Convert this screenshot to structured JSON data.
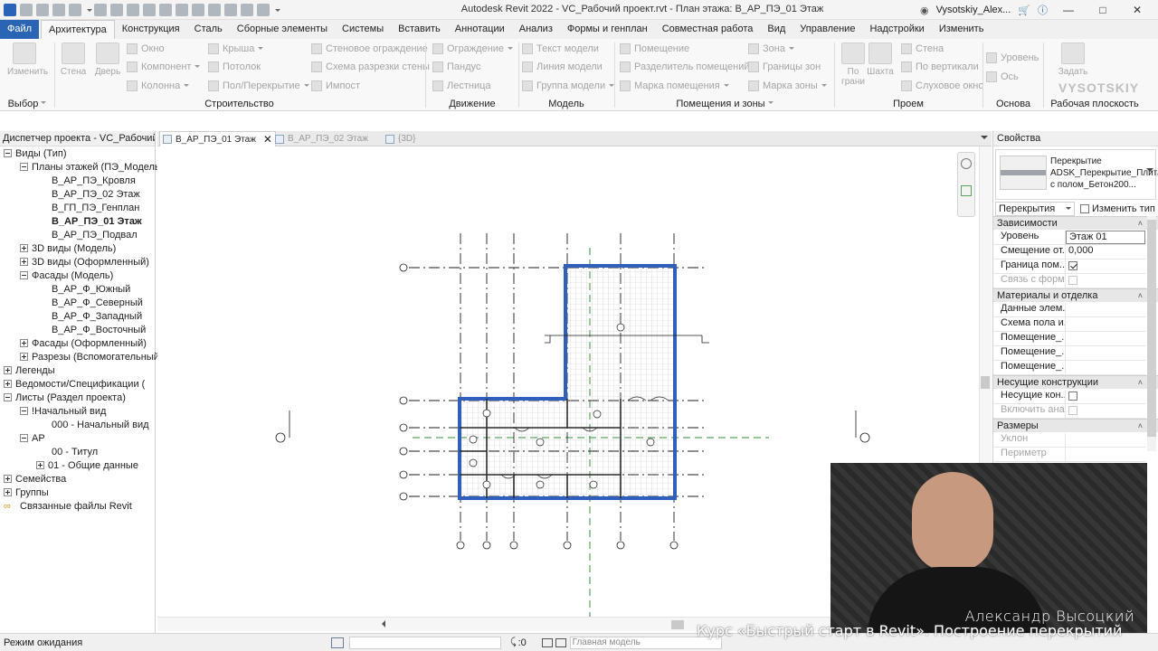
{
  "window": {
    "title": "Autodesk Revit 2022 - VC_Рабочий проект.rvt - План этажа: В_АР_ПЭ_01 Этаж",
    "user": "Vysotskiy_Alex..."
  },
  "tabs": [
    {
      "label": "Файл"
    },
    {
      "label": "Архитектура"
    },
    {
      "label": "Конструкция"
    },
    {
      "label": "Сталь"
    },
    {
      "label": "Сборные элементы"
    },
    {
      "label": "Системы"
    },
    {
      "label": "Вставить"
    },
    {
      "label": "Аннотации"
    },
    {
      "label": "Анализ"
    },
    {
      "label": "Формы и генплан"
    },
    {
      "label": "Совместная работа"
    },
    {
      "label": "Вид"
    },
    {
      "label": "Управление"
    },
    {
      "label": "Надстройки"
    },
    {
      "label": "Изменить"
    }
  ],
  "ribbon": {
    "select": {
      "modify": "Изменить",
      "title": "Выбор"
    },
    "build": {
      "wall": "Стена",
      "door": "Дверь",
      "window": "Окно",
      "component": "Компонент",
      "column": "Колонна",
      "roof": "Крыша",
      "ceiling": "Потолок",
      "floor": "Пол/Перекрытие",
      "curtain_wall": "Стеновое ограждение",
      "curtain_grid": "Схема разрезки стены",
      "mullion": "Импост",
      "title": "Строительство"
    },
    "circulation": {
      "railing": "Ограждение",
      "ramp": "Пандус",
      "stair": "Лестница",
      "title": "Движение"
    },
    "model": {
      "text": "Текст модели",
      "line": "Линия модели",
      "group": "Группа модели",
      "title": "Модель"
    },
    "rooms": {
      "room": "Помещение",
      "separator": "Разделитель помещений",
      "tag": "Марка помещения",
      "area": "Зона",
      "area_boundary": "Границы зон",
      "area_tag": "Марка зоны",
      "title": "Помещения и зоны"
    },
    "opening": {
      "by_face": "По грани",
      "shaft": "Шахта",
      "wall": "Стена",
      "vertical": "По вертикали",
      "dormer": "Слуховое окно",
      "title": "Проем"
    },
    "datum": {
      "level": "Уровень",
      "grid": "Ось",
      "title": "Основа"
    },
    "workplane": {
      "set": "Задать",
      "title": "Рабочая плоскость"
    }
  },
  "browser": {
    "title": "Диспетчер проекта - VC_Рабочий...",
    "items": [
      {
        "label": "Виды (Тип)",
        "state": "minus"
      },
      {
        "label": "Планы этажей (ПЭ_Модель",
        "state": "minus"
      },
      {
        "label": "В_АР_ПЭ_Кровля"
      },
      {
        "label": "В_АР_ПЭ_02 Этаж"
      },
      {
        "label": "В_ГП_ПЭ_Генплан"
      },
      {
        "label": "В_АР_ПЭ_01 Этаж"
      },
      {
        "label": "В_АР_ПЭ_Подвал"
      },
      {
        "label": "3D виды (Модель)",
        "state": "plus"
      },
      {
        "label": "3D виды (Оформленный)",
        "state": "plus"
      },
      {
        "label": "Фасады (Модель)",
        "state": "minus"
      },
      {
        "label": "В_АР_Ф_Южный"
      },
      {
        "label": "В_АР_Ф_Северный"
      },
      {
        "label": "В_АР_Ф_Западный"
      },
      {
        "label": "В_АР_Ф_Восточный"
      },
      {
        "label": "Фасады (Оформленный)",
        "state": "plus"
      },
      {
        "label": "Разрезы (Вспомогательный",
        "state": "plus"
      },
      {
        "label": "Легенды",
        "state": "plus"
      },
      {
        "label": "Ведомости/Спецификации (",
        "state": "plus"
      },
      {
        "label": "Листы (Раздел проекта)",
        "state": "minus"
      },
      {
        "label": "!Начальный вид",
        "state": "minus"
      },
      {
        "label": "000 - Начальный вид"
      },
      {
        "label": "АР",
        "state": "minus"
      },
      {
        "label": "00 - Титул"
      },
      {
        "label": "01 - Общие данные",
        "state": "plus"
      },
      {
        "label": "Семейства",
        "state": "plus"
      },
      {
        "label": "Группы",
        "state": "plus"
      },
      {
        "label": "Связанные файлы Revit"
      }
    ]
  },
  "doc_tabs": [
    {
      "label": "В_АР_ПЭ_01 Этаж"
    },
    {
      "label": "В_АР_ПЭ_02 Этаж"
    },
    {
      "label": "{3D}"
    }
  ],
  "properties": {
    "title": "Свойства",
    "type_name": "Перекрытие ADSK_Перекрытие_Плита с полом_Бетон200...",
    "filter": "Перекрытия",
    "edit_type": "Изменить тип",
    "sections": [
      {
        "title": "Зависимости",
        "rows": [
          {
            "k": "Уровень",
            "v": "Этаж 01"
          },
          {
            "k": "Смещение от...",
            "v": "0,000"
          },
          {
            "k": "Граница пом...",
            "check": true
          },
          {
            "k": "Связь с форм...",
            "check": false
          }
        ]
      },
      {
        "title": "Материалы и отделка",
        "rows": [
          {
            "k": "Данные элем...",
            "v": ""
          },
          {
            "k": "Схема пола и...",
            "v": ""
          },
          {
            "k": "Помещение_...",
            "v": ""
          },
          {
            "k": "Помещение_...",
            "v": ""
          },
          {
            "k": "Помещение_...",
            "v": ""
          }
        ]
      },
      {
        "title": "Несущие конструкции",
        "rows": [
          {
            "k": "Несущие кон...",
            "check": false
          },
          {
            "k": "Включить ана...",
            "check": false
          }
        ]
      },
      {
        "title": "Размеры",
        "rows": [
          {
            "k": "Уклон",
            "v": ""
          },
          {
            "k": "Периметр",
            "v": ""
          }
        ]
      }
    ]
  },
  "status": {
    "text": "Режим ожидания",
    "count": ":0",
    "model": "Главная модель"
  },
  "overlay": {
    "presenter": "Александр Высоцкий",
    "caption": "Курс «Быстрый старт в Revit». Построение перекрытий",
    "watermark": "VYSOTSKIY"
  },
  "colors": {
    "accent": "#2a64b4",
    "floor_outline": "#2f5fb8",
    "grid_dash": "#1e1e1e",
    "green_line": "#5aa35a"
  }
}
